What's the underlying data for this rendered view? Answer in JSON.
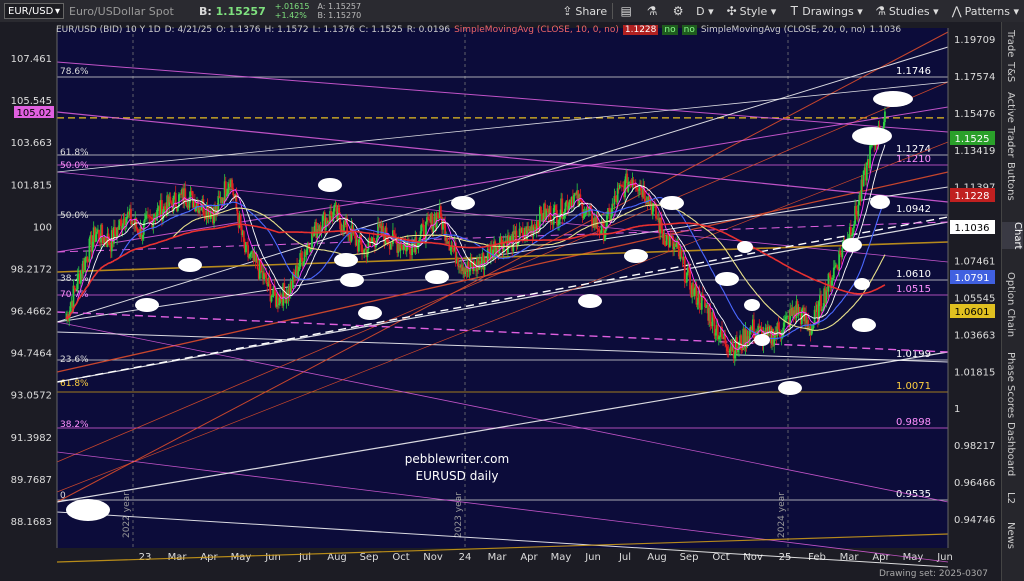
{
  "toolbar": {
    "symbol": "EUR/USD",
    "description": "Euro/USDollar Spot",
    "bid_label": "B:",
    "bid_value": "1.15257",
    "change": "+.01615",
    "change_pct": "+1.42%",
    "ask_a": "A: 1.15257",
    "ask_b": "B: 1.15270",
    "share": "Share",
    "period": "D",
    "style": "Style",
    "drawings": "Drawings",
    "studies": "Studies",
    "patterns": "Patterns"
  },
  "legend": {
    "symbol": "EUR/USD (BID) 10 Y 1D",
    "date": "D: 4/21/25",
    "open": "O: 1.1376",
    "high": "H: 1.1572",
    "low": "L: 1.1376",
    "close": "C: 1.1525",
    "range": "R: 0.0196",
    "sma10": "SimpleMovingAvg (CLOSE, 10, 0, no)",
    "sma10_value": "1.1228",
    "no1": "no",
    "no2": "no",
    "sma20": "SimpleMovingAvg (CLOSE, 20, 0, no)",
    "sma20_value": "1.1036"
  },
  "right_tabs": [
    "Trade",
    "T&S",
    "Active Trader",
    "Buttons",
    "Chart",
    "Option Chain",
    "Phase Scores",
    "Dashboard",
    "L2",
    "News"
  ],
  "drawing_set": "Drawing set: 2025-0307",
  "colors": {
    "background": "#0c0c3a",
    "price_up": "#2ecc40",
    "price_down": "#e02020",
    "magenta": "#e060e0",
    "gold": "#d4a017",
    "white": "#ffffff",
    "orange_red": "#e8502a"
  },
  "chart_data": {
    "type": "line",
    "title": "EUR/USD (BID) 10 Y 1D",
    "x_ticks": [
      "23",
      "Mar",
      "Apr",
      "May",
      "Jun",
      "Jul",
      "Aug",
      "Sep",
      "Oct",
      "Nov",
      "24",
      "Mar",
      "Apr",
      "May",
      "Jun",
      "Jul",
      "Aug",
      "Sep",
      "Oct",
      "Nov",
      "25",
      "Feb",
      "Mar",
      "Apr",
      "May",
      "Jun"
    ],
    "left_ticks": [
      "107.461",
      "105.545",
      "103.663",
      "101.815",
      "100",
      "98.2172",
      "96.4662",
      "94.7464",
      "93.0572",
      "91.3982",
      "89.7687",
      "88.1683"
    ],
    "left_highlight": "105.02",
    "right_ticks": [
      "1.19709",
      "1.17574",
      "1.15476",
      "1.13419",
      "1.11397",
      "1.09411",
      "1.07461",
      "1.05545",
      "1.03663",
      "1.01815",
      "1",
      "0.98217",
      "0.96466",
      "0.94746"
    ],
    "fib_labels": [
      "78.6%",
      "61.8%",
      "50.0%",
      "50.0%",
      "38.2%",
      "70.7%",
      "23.6%",
      "61.8%",
      "38.2%",
      "0"
    ],
    "level_labels": [
      "1.1746",
      "1.1274",
      "1.1210",
      "1.0942",
      "1.0610",
      "1.0515",
      "1.0199",
      "1.0071",
      "0.9898",
      "0.9535"
    ],
    "price_tags": [
      {
        "value": "1.1525",
        "color": "#2aa02a"
      },
      {
        "value": "1.1228",
        "color": "#c02020"
      },
      {
        "value": "1.1036",
        "color": "#ffffff"
      },
      {
        "value": "1.0791",
        "color": "#4060e0"
      },
      {
        "value": "1.0601",
        "color": "#e0c020"
      }
    ],
    "annotation_text": [
      "pebblewriter.com",
      "EURUSD daily"
    ],
    "year_labels": [
      "2022 year",
      "2023 year",
      "2024 year"
    ],
    "series": [
      {
        "values": [
          1.045,
          1.07,
          1.09,
          1.085,
          1.1,
          1.09,
          1.1,
          1.105,
          1.11,
          1.105,
          1.1,
          1.12,
          1.08,
          1.07,
          1.055,
          1.06,
          1.08,
          1.095,
          1.1,
          1.09,
          1.08,
          1.09,
          1.085,
          1.083,
          1.09,
          1.1,
          1.08,
          1.07,
          1.075,
          1.085,
          1.085,
          1.09,
          1.1,
          1.1,
          1.11,
          1.1,
          1.09,
          1.11,
          1.12,
          1.11,
          1.09,
          1.08,
          1.06,
          1.05,
          1.035,
          1.03,
          1.04,
          1.035,
          1.04,
          1.05,
          1.04,
          1.06,
          1.08,
          1.1,
          1.135,
          1.1525
        ]
      }
    ]
  }
}
